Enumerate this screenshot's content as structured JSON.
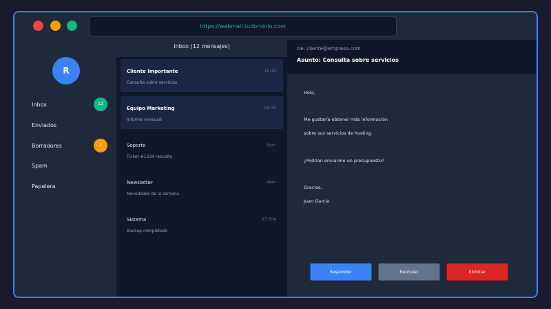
{
  "browser": {
    "url": "https://webmail.tudominio.com"
  },
  "colors": {
    "accent": "#3b82f6",
    "close": "#ef4444",
    "minimize": "#f59e0b",
    "maximize": "#10b981",
    "reply": "#3b82f6",
    "forward": "#64748b",
    "delete": "#dc2626"
  },
  "sidebar": {
    "avatar_initial": "R",
    "folders": [
      {
        "label": "Inbox",
        "badge": "12",
        "badge_color": "#10b981"
      },
      {
        "label": "Enviados"
      },
      {
        "label": "Borradores",
        "badge": "2",
        "badge_color": "#f59e0b"
      },
      {
        "label": "Spam"
      },
      {
        "label": "Papelera"
      }
    ]
  },
  "maillist": {
    "header": "Inbox (12 mensajes)",
    "items": [
      {
        "from": "Cliente Importante",
        "time": "10:45",
        "subject": "Consulta sobre servicios",
        "unread": true
      },
      {
        "from": "Equipo Marketing",
        "time": "09:30",
        "subject": "Informe mensual",
        "unread": true
      },
      {
        "from": "Soporte",
        "time": "Ayer",
        "subject": "Ticket #1234 resuelto",
        "unread": false
      },
      {
        "from": "Newsletter",
        "time": "Ayer",
        "subject": "Novedades de la semana",
        "unread": false
      },
      {
        "from": "Sistema",
        "time": "15 Ene",
        "subject": "Backup completado",
        "unread": false
      }
    ]
  },
  "reader": {
    "from": "De: cliente@empresa.com",
    "subject": "Asunto: Consulta sobre servicios",
    "body": [
      "Hola,",
      "Me gustaría obtener más información",
      "sobre sus servicios de hosting.",
      "¿Podrían enviarme un presupuesto?",
      "Gracias,",
      "Juan García"
    ],
    "actions": {
      "reply": "Responder",
      "forward": "Reenviar",
      "delete": "Eliminar"
    }
  }
}
